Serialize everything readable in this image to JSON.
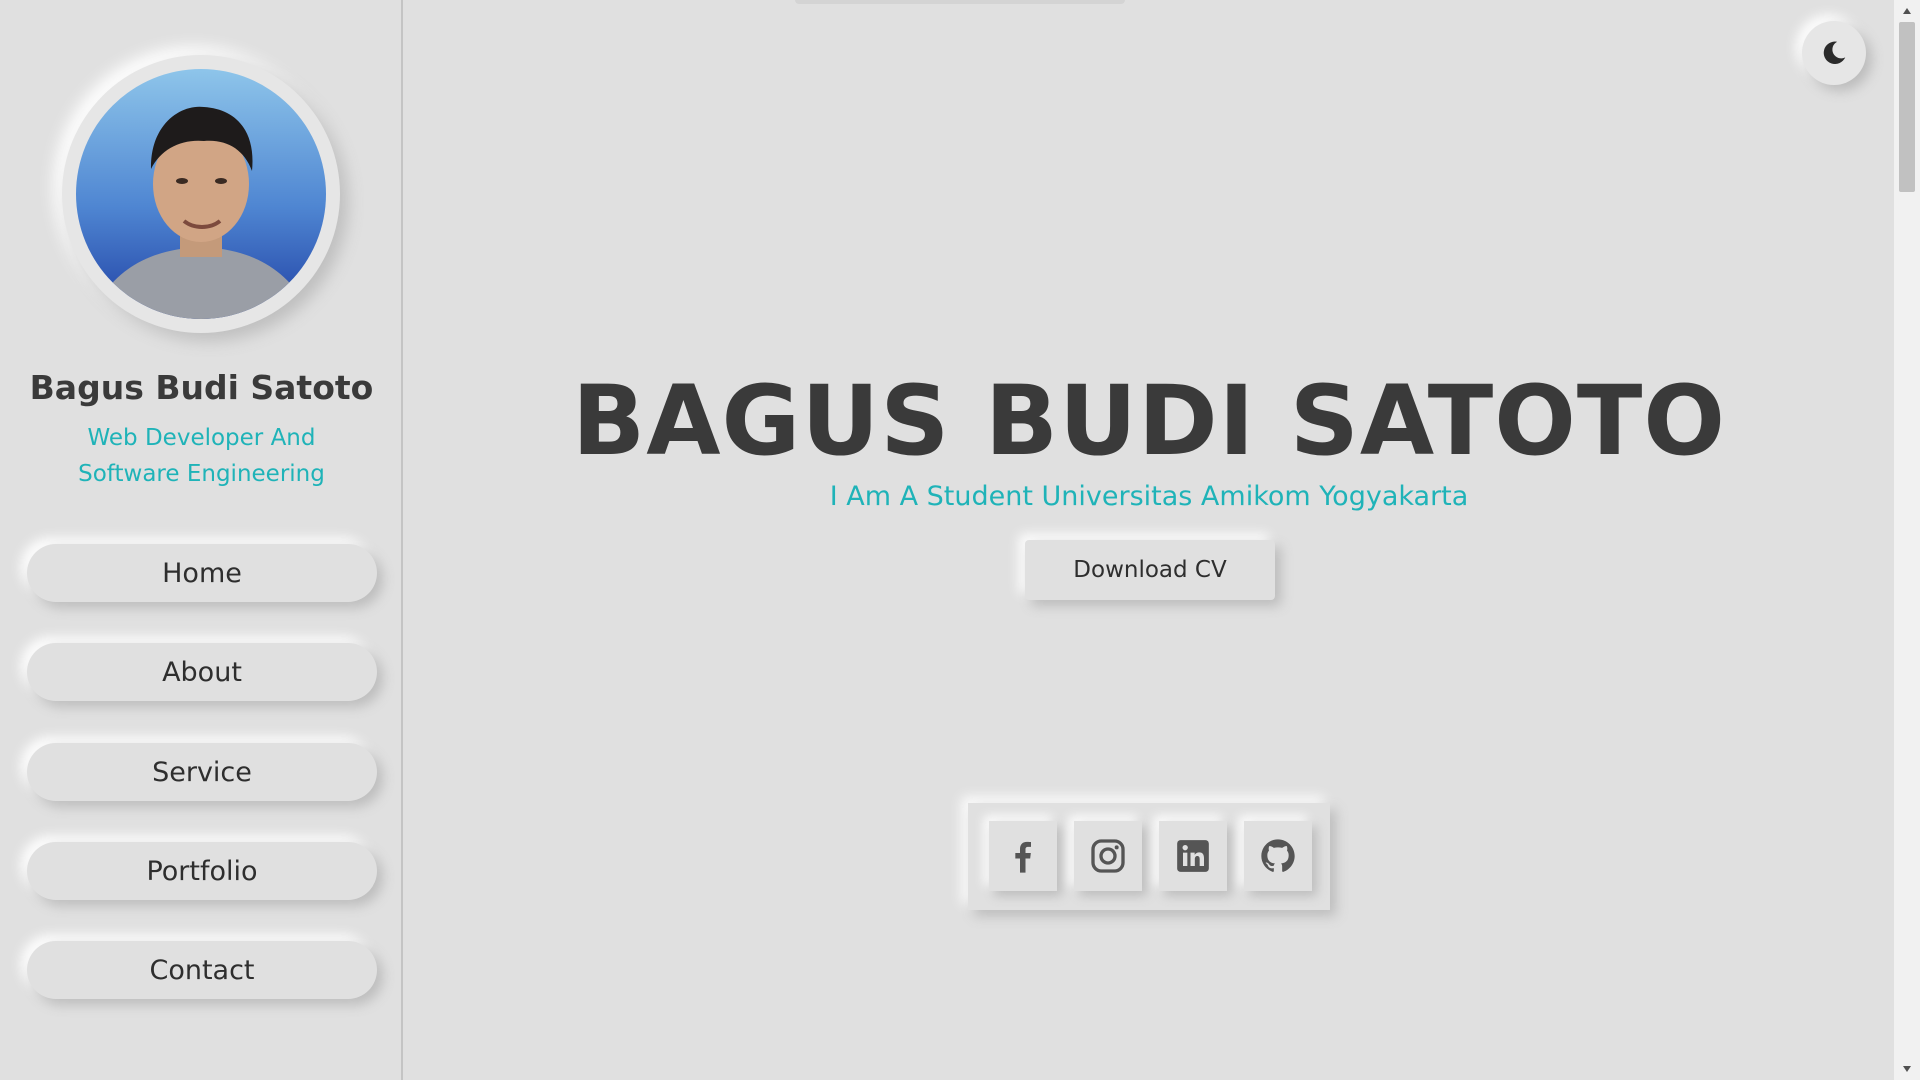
{
  "sidebar": {
    "name": "Bagus Budi Satoto",
    "role": "Web Developer And Software Engineering",
    "nav": [
      {
        "label": "Home"
      },
      {
        "label": "About"
      },
      {
        "label": "Service"
      },
      {
        "label": "Portfolio"
      },
      {
        "label": "Contact"
      }
    ]
  },
  "hero": {
    "title": "BAGUS BUDI SATOTO",
    "subtitle": "I Am A Student Universitas Amikom Yogyakarta",
    "cta_label": "Download CV"
  },
  "social": [
    {
      "icon": "facebook-icon"
    },
    {
      "icon": "instagram-icon"
    },
    {
      "icon": "linkedin-icon"
    },
    {
      "icon": "github-icon"
    }
  ],
  "theme_toggle": {
    "icon": "moon-icon"
  },
  "colors": {
    "background": "#e0e0e0",
    "accent": "#1fb3b8",
    "text": "#3a3a3a"
  }
}
